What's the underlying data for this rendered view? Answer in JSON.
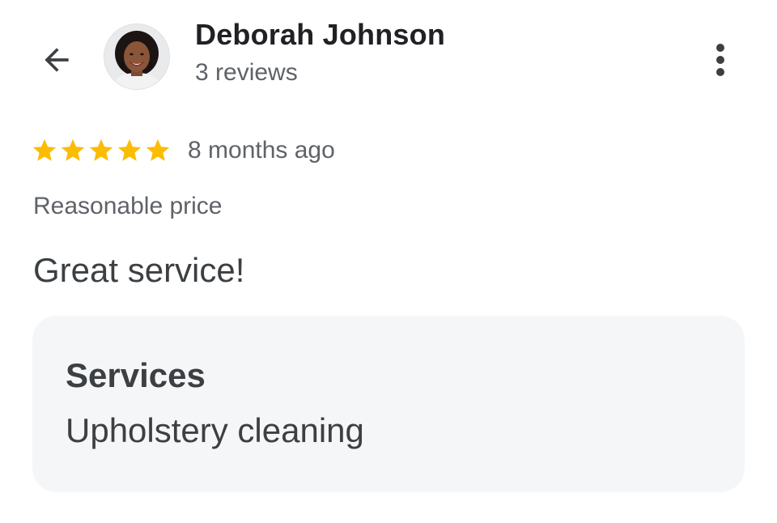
{
  "header": {
    "back_icon": "arrow-back-icon",
    "avatar_icon": "profile-photo",
    "reviewer_name": "Deborah Johnson",
    "review_count": "3 reviews",
    "more_icon": "more-vert-icon"
  },
  "review": {
    "rating": 5,
    "rating_max": 5,
    "star_color": "#fbbc04",
    "time_ago": "8 months ago",
    "attribute": "Reasonable price",
    "text": "Great service!"
  },
  "services": {
    "title": "Services",
    "value": "Upholstery cleaning"
  },
  "colors": {
    "primary_text": "#202124",
    "secondary_text": "#5f6368",
    "card_background": "#f5f6f8"
  }
}
